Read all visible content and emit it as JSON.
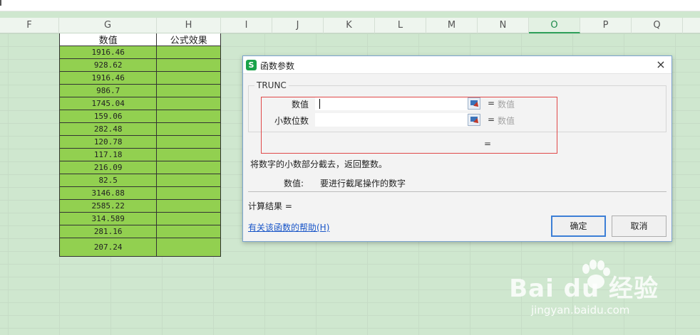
{
  "columns": [
    {
      "letter": "F"
    },
    {
      "letter": "G"
    },
    {
      "letter": "H"
    },
    {
      "letter": "I"
    },
    {
      "letter": "J"
    },
    {
      "letter": "K"
    },
    {
      "letter": "L"
    },
    {
      "letter": "M"
    },
    {
      "letter": "N"
    },
    {
      "letter": "O"
    },
    {
      "letter": "P"
    },
    {
      "letter": "Q"
    }
  ],
  "selected_column": "O",
  "table": {
    "headers": [
      "数值",
      "公式效果"
    ],
    "values": [
      "1916.46",
      "928.62",
      "1916.46",
      "986.7",
      "1745.04",
      "159.06",
      "282.48",
      "120.78",
      "117.18",
      "216.09",
      "82.5",
      "3146.88",
      "2585.22",
      "314.589",
      "281.16",
      "207.24"
    ],
    "cell_color": "#92d050"
  },
  "dialog": {
    "title": "函数参数",
    "app_icon": "S",
    "close_icon": "×",
    "function_name": "TRUNC",
    "args": [
      {
        "label": "数值",
        "eq": "=",
        "value": "数值"
      },
      {
        "label": "小数位数",
        "eq": "=",
        "value": "数值"
      }
    ],
    "result_eq": "=",
    "description": "将数字的小数部分截去，返回整数。",
    "arg_desc_label": "数值:",
    "arg_desc_text": "要进行截尾操作的数字",
    "calc_result": "计算结果 =",
    "help_link": "有关该函数的帮助(H)",
    "ok_label": "确定",
    "cancel_label": "取消",
    "highlight_color": "#e04848"
  },
  "watermark": {
    "brand": "Bai du 经验",
    "url": "jingyan.baidu.com"
  }
}
